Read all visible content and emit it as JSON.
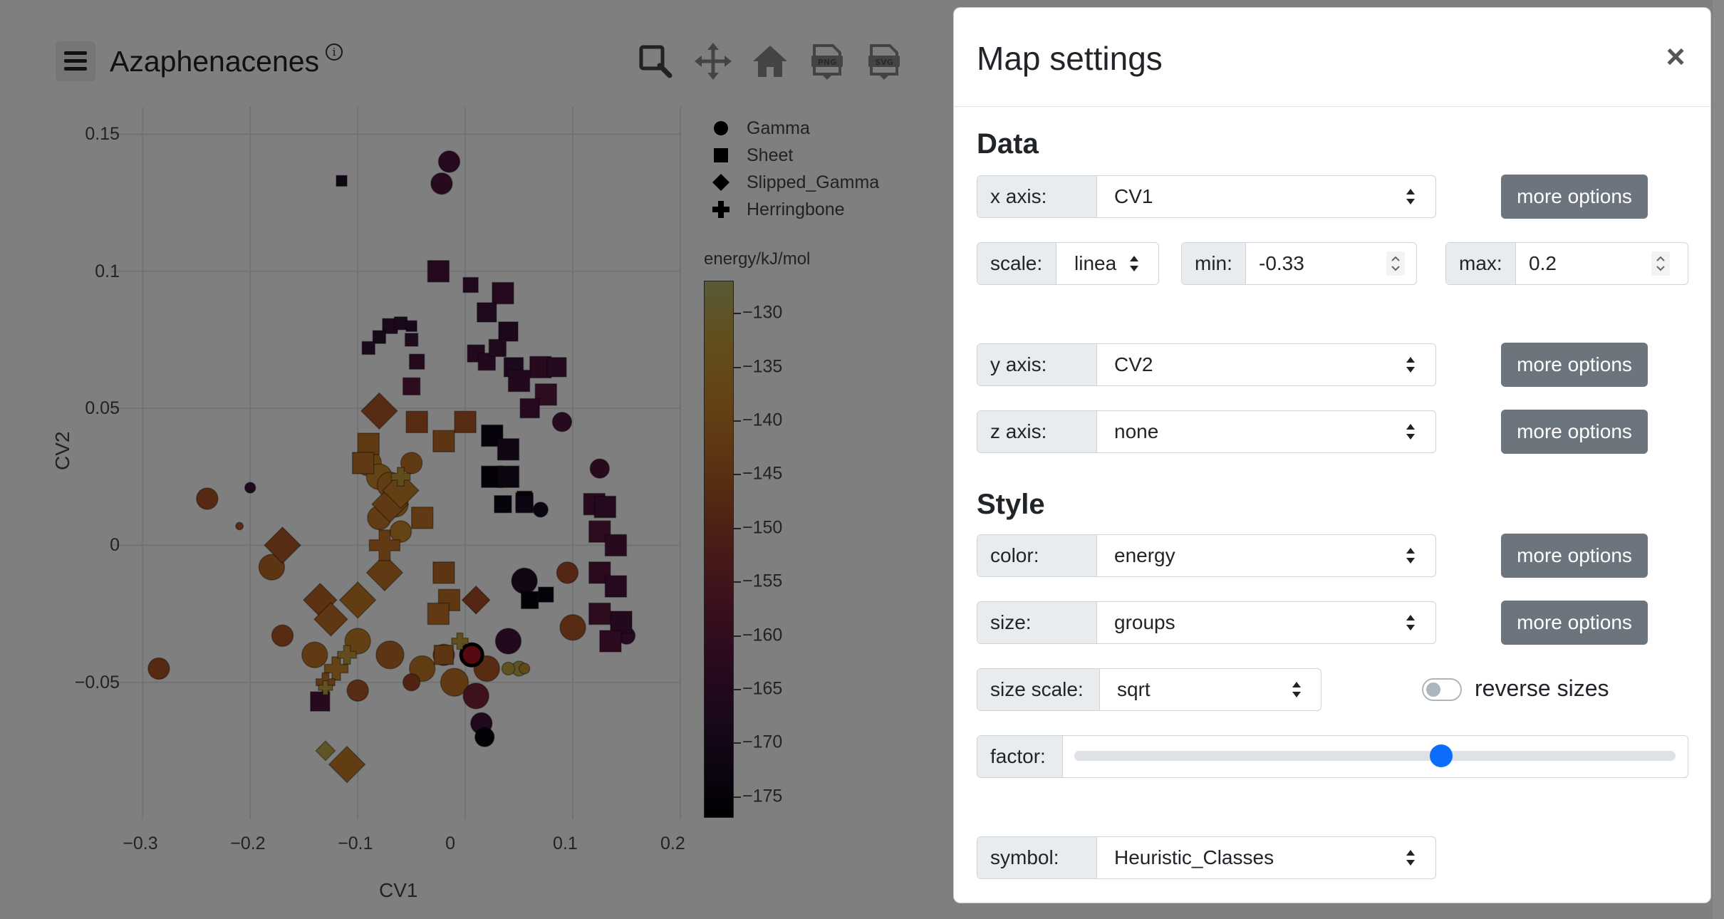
{
  "header": {
    "title": "Azaphenacenes",
    "info_symbol": "i",
    "toolbar_icons": [
      "zoom-icon",
      "pan-icon",
      "home-icon",
      "download-png-icon",
      "download-svg-icon"
    ]
  },
  "chart_data": {
    "type": "scatter",
    "xlabel": "CV1",
    "ylabel": "CV2",
    "xlim": [
      -0.33,
      0.2
    ],
    "ylim": [
      -0.1,
      0.16
    ],
    "x_ticks": [
      "−0.3",
      "−0.2",
      "−0.1",
      "0",
      "0.1",
      "0.2"
    ],
    "x_tick_values": [
      -0.3,
      -0.2,
      -0.1,
      0,
      0.1,
      0.2
    ],
    "y_ticks": [
      "0.15",
      "0.1",
      "0.05",
      "0",
      "−0.05"
    ],
    "y_tick_values": [
      0.15,
      0.1,
      0.05,
      0,
      -0.05
    ],
    "grid": true,
    "legend": [
      {
        "name": "Gamma",
        "symbol": "circle"
      },
      {
        "name": "Sheet",
        "symbol": "square"
      },
      {
        "name": "Slipped_Gamma",
        "symbol": "diamond"
      },
      {
        "name": "Herringbone",
        "symbol": "cross"
      }
    ],
    "colorbar": {
      "title": "energy/kJ/mol",
      "range": [
        -177,
        -127
      ],
      "tick_values": [
        -130,
        -135,
        -140,
        -145,
        -150,
        -155,
        -160,
        -165,
        -170,
        -175
      ],
      "tick_labels": [
        "−130",
        "−135",
        "−140",
        "−145",
        "−150",
        "−155",
        "−160",
        "−165",
        "−170",
        "−175"
      ],
      "colorscale": "inferno"
    },
    "series": [
      {
        "name": "Gamma",
        "points": [
          {
            "x": -0.015,
            "y": 0.14,
            "e": -163,
            "s": 1.0
          },
          {
            "x": -0.022,
            "y": 0.132,
            "e": -162,
            "s": 1.0
          },
          {
            "x": -0.2,
            "y": 0.021,
            "e": -165,
            "s": 0.5
          },
          {
            "x": -0.24,
            "y": 0.017,
            "e": -146,
            "s": 1.0
          },
          {
            "x": -0.21,
            "y": 0.007,
            "e": -145,
            "s": 0.35
          },
          {
            "x": -0.285,
            "y": -0.045,
            "e": -146,
            "s": 1.0
          },
          {
            "x": -0.18,
            "y": -0.008,
            "e": -142,
            "s": 1.2
          },
          {
            "x": -0.09,
            "y": 0.03,
            "e": -138,
            "s": 1.2
          },
          {
            "x": -0.08,
            "y": 0.025,
            "e": -137,
            "s": 1.2
          },
          {
            "x": -0.07,
            "y": 0.022,
            "e": -139,
            "s": 1.2
          },
          {
            "x": -0.065,
            "y": 0.015,
            "e": -138,
            "s": 1.2
          },
          {
            "x": -0.05,
            "y": 0.03,
            "e": -140,
            "s": 1.0
          },
          {
            "x": -0.08,
            "y": 0.01,
            "e": -139,
            "s": 1.1
          },
          {
            "x": -0.06,
            "y": 0.005,
            "e": -137,
            "s": 1.0
          },
          {
            "x": -0.17,
            "y": -0.033,
            "e": -145,
            "s": 1.0
          },
          {
            "x": -0.14,
            "y": -0.04,
            "e": -140,
            "s": 1.2
          },
          {
            "x": -0.1,
            "y": -0.035,
            "e": -138,
            "s": 1.2
          },
          {
            "x": -0.07,
            "y": -0.04,
            "e": -142,
            "s": 1.3
          },
          {
            "x": -0.04,
            "y": -0.045,
            "e": -139,
            "s": 1.2
          },
          {
            "x": -0.02,
            "y": -0.04,
            "e": -141,
            "s": 1.0
          },
          {
            "x": -0.1,
            "y": -0.053,
            "e": -145,
            "s": 1.0
          },
          {
            "x": -0.05,
            "y": -0.05,
            "e": -148,
            "s": 0.8
          },
          {
            "x": -0.01,
            "y": -0.05,
            "e": -140,
            "s": 1.3
          },
          {
            "x": 0.02,
            "y": -0.045,
            "e": -145,
            "s": 1.2
          },
          {
            "x": 0.01,
            "y": -0.055,
            "e": -155,
            "s": 1.2
          },
          {
            "x": 0.015,
            "y": -0.065,
            "e": -165,
            "s": 1.0
          },
          {
            "x": 0.018,
            "y": -0.07,
            "e": -175,
            "s": 0.9
          },
          {
            "x": 0.04,
            "y": -0.035,
            "e": -164,
            "s": 1.2
          },
          {
            "x": 0.05,
            "y": -0.045,
            "e": -130,
            "s": 0.7
          },
          {
            "x": 0.04,
            "y": -0.045,
            "e": -131,
            "s": 0.6
          },
          {
            "x": 0.055,
            "y": -0.045,
            "e": -135,
            "s": 0.5
          },
          {
            "x": 0.1,
            "y": -0.03,
            "e": -145,
            "s": 1.2
          },
          {
            "x": 0.095,
            "y": -0.01,
            "e": -147,
            "s": 1.0
          },
          {
            "x": 0.125,
            "y": 0.028,
            "e": -162,
            "s": 0.9
          },
          {
            "x": 0.15,
            "y": -0.033,
            "e": -163,
            "s": 0.8
          },
          {
            "x": 0.09,
            "y": 0.045,
            "e": -162,
            "s": 0.9
          },
          {
            "x": 0.055,
            "y": -0.013,
            "e": -170,
            "s": 1.2
          },
          {
            "x": 0.07,
            "y": 0.013,
            "e": -172,
            "s": 0.7
          },
          {
            "x": 0.006,
            "y": -0.04,
            "e": -145,
            "s": 1.0,
            "highlight": true
          }
        ]
      },
      {
        "name": "Sheet",
        "points": [
          {
            "x": -0.115,
            "y": 0.133,
            "e": -170,
            "s": 0.5
          },
          {
            "x": -0.025,
            "y": 0.1,
            "e": -163,
            "s": 1.0
          },
          {
            "x": 0.005,
            "y": 0.095,
            "e": -165,
            "s": 0.7
          },
          {
            "x": 0.035,
            "y": 0.092,
            "e": -163,
            "s": 1.0
          },
          {
            "x": 0.02,
            "y": 0.085,
            "e": -165,
            "s": 0.9
          },
          {
            "x": 0.04,
            "y": 0.078,
            "e": -166,
            "s": 0.9
          },
          {
            "x": -0.07,
            "y": 0.08,
            "e": -166,
            "s": 0.7
          },
          {
            "x": -0.06,
            "y": 0.081,
            "e": -166,
            "s": 0.6
          },
          {
            "x": -0.05,
            "y": 0.08,
            "e": -167,
            "s": 0.5
          },
          {
            "x": -0.08,
            "y": 0.076,
            "e": -168,
            "s": 0.6
          },
          {
            "x": -0.05,
            "y": 0.075,
            "e": -165,
            "s": 0.6
          },
          {
            "x": -0.09,
            "y": 0.072,
            "e": -166,
            "s": 0.6
          },
          {
            "x": -0.045,
            "y": 0.067,
            "e": -163,
            "s": 0.7
          },
          {
            "x": 0.01,
            "y": 0.07,
            "e": -164,
            "s": 0.8
          },
          {
            "x": 0.02,
            "y": 0.067,
            "e": -164,
            "s": 0.8
          },
          {
            "x": 0.03,
            "y": 0.072,
            "e": -165,
            "s": 0.8
          },
          {
            "x": 0.045,
            "y": 0.065,
            "e": -166,
            "s": 0.9
          },
          {
            "x": 0.07,
            "y": 0.065,
            "e": -162,
            "s": 1.0
          },
          {
            "x": 0.085,
            "y": 0.065,
            "e": -163,
            "s": 0.9
          },
          {
            "x": 0.05,
            "y": 0.06,
            "e": -164,
            "s": 1.0
          },
          {
            "x": 0.075,
            "y": 0.055,
            "e": -160,
            "s": 1.0
          },
          {
            "x": 0.06,
            "y": 0.05,
            "e": -163,
            "s": 0.9
          },
          {
            "x": -0.05,
            "y": 0.058,
            "e": -160,
            "s": 0.8
          },
          {
            "x": -0.045,
            "y": 0.045,
            "e": -145,
            "s": 1.0
          },
          {
            "x": 0.0,
            "y": 0.045,
            "e": -145,
            "s": 1.0
          },
          {
            "x": 0.025,
            "y": 0.04,
            "e": -174,
            "s": 1.0
          },
          {
            "x": 0.04,
            "y": 0.035,
            "e": -170,
            "s": 1.0
          },
          {
            "x": 0.025,
            "y": 0.025,
            "e": -175,
            "s": 1.0
          },
          {
            "x": 0.04,
            "y": 0.025,
            "e": -172,
            "s": 1.0
          },
          {
            "x": 0.035,
            "y": 0.015,
            "e": -174,
            "s": 0.8
          },
          {
            "x": 0.055,
            "y": 0.017,
            "e": -174,
            "s": 0.7
          },
          {
            "x": 0.055,
            "y": 0.016,
            "e": -175,
            "s": 0.8
          },
          {
            "x": -0.02,
            "y": 0.038,
            "e": -142,
            "s": 1.0
          },
          {
            "x": -0.09,
            "y": 0.037,
            "e": -140,
            "s": 1.0
          },
          {
            "x": -0.095,
            "y": 0.03,
            "e": -140,
            "s": 1.0
          },
          {
            "x": -0.04,
            "y": 0.01,
            "e": -140,
            "s": 1.0
          },
          {
            "x": 0.055,
            "y": 0.015,
            "e": -171,
            "s": 0.8
          },
          {
            "x": 0.12,
            "y": 0.015,
            "e": -162,
            "s": 1.0
          },
          {
            "x": 0.13,
            "y": 0.014,
            "e": -163,
            "s": 1.0
          },
          {
            "x": 0.125,
            "y": 0.005,
            "e": -160,
            "s": 1.0
          },
          {
            "x": 0.14,
            "y": 0.0,
            "e": -162,
            "s": 1.0
          },
          {
            "x": 0.125,
            "y": -0.01,
            "e": -161,
            "s": 1.0
          },
          {
            "x": 0.14,
            "y": -0.015,
            "e": -163,
            "s": 1.0
          },
          {
            "x": 0.125,
            "y": -0.025,
            "e": -160,
            "s": 1.0
          },
          {
            "x": 0.145,
            "y": -0.028,
            "e": -164,
            "s": 1.0
          },
          {
            "x": 0.135,
            "y": -0.035,
            "e": -161,
            "s": 1.0
          },
          {
            "x": 0.06,
            "y": -0.02,
            "e": -175,
            "s": 0.8
          },
          {
            "x": 0.075,
            "y": -0.018,
            "e": -174,
            "s": 0.7
          },
          {
            "x": -0.02,
            "y": -0.01,
            "e": -142,
            "s": 1.0
          },
          {
            "x": -0.015,
            "y": -0.02,
            "e": -141,
            "s": 1.0
          },
          {
            "x": -0.025,
            "y": -0.025,
            "e": -140,
            "s": 1.0
          },
          {
            "x": -0.135,
            "y": -0.057,
            "e": -162,
            "s": 0.9
          },
          {
            "x": -0.02,
            "y": -0.04,
            "e": -142,
            "s": 0.9
          }
        ]
      },
      {
        "name": "Slipped_Gamma",
        "points": [
          {
            "x": -0.08,
            "y": 0.049,
            "e": -145,
            "s": 1.3
          },
          {
            "x": -0.17,
            "y": 0.0,
            "e": -145,
            "s": 1.3
          },
          {
            "x": -0.07,
            "y": 0.015,
            "e": -140,
            "s": 1.3
          },
          {
            "x": -0.06,
            "y": 0.02,
            "e": -138,
            "s": 1.3
          },
          {
            "x": -0.075,
            "y": -0.01,
            "e": -140,
            "s": 1.3
          },
          {
            "x": -0.135,
            "y": -0.02,
            "e": -143,
            "s": 1.2
          },
          {
            "x": -0.1,
            "y": -0.02,
            "e": -139,
            "s": 1.3
          },
          {
            "x": -0.125,
            "y": -0.027,
            "e": -141,
            "s": 1.2
          },
          {
            "x": 0.01,
            "y": -0.02,
            "e": -147,
            "s": 1.0
          },
          {
            "x": -0.13,
            "y": -0.075,
            "e": -130,
            "s": 0.7
          },
          {
            "x": -0.11,
            "y": -0.08,
            "e": -139,
            "s": 1.3
          }
        ]
      },
      {
        "name": "Herringbone",
        "points": [
          {
            "x": -0.075,
            "y": 0.0,
            "e": -140,
            "s": 1.3
          },
          {
            "x": -0.12,
            "y": -0.045,
            "e": -137,
            "s": 1.0
          },
          {
            "x": -0.11,
            "y": -0.04,
            "e": -133,
            "s": 0.8
          },
          {
            "x": -0.13,
            "y": -0.05,
            "e": -140,
            "s": 0.8
          },
          {
            "x": -0.13,
            "y": -0.052,
            "e": -131,
            "s": 0.6
          },
          {
            "x": -0.06,
            "y": 0.025,
            "e": -133,
            "s": 0.8
          },
          {
            "x": -0.005,
            "y": -0.035,
            "e": -132,
            "s": 0.7
          }
        ]
      }
    ]
  },
  "modal": {
    "title": "Map settings",
    "close_symbol": "×",
    "data_section_title": "Data",
    "x_axis": {
      "label": "x axis:",
      "value": "CV1",
      "button": "more options"
    },
    "scale": {
      "label": "scale:",
      "value": "linea"
    },
    "min": {
      "label": "min:",
      "value": "-0.33"
    },
    "max": {
      "label": "max:",
      "value": "0.2"
    },
    "y_axis": {
      "label": "y axis:",
      "value": "CV2",
      "button": "more options"
    },
    "z_axis": {
      "label": "z axis:",
      "value": "none",
      "button": "more options"
    },
    "style_section_title": "Style",
    "color": {
      "label": "color:",
      "value": "energy",
      "button": "more options"
    },
    "size": {
      "label": "size:",
      "value": "groups",
      "button": "more options"
    },
    "size_scale": {
      "label": "size scale:",
      "value": "sqrt"
    },
    "reverse_sizes": {
      "label": "reverse sizes",
      "checked": false
    },
    "factor": {
      "label": "factor:",
      "value": 0.61
    },
    "symbol": {
      "label": "symbol:",
      "value": "Heuristic_Classes"
    }
  },
  "colors": {
    "accent": "#0d6efd",
    "button_secondary": "#6c757d",
    "highlight_marker": "#b01020"
  }
}
